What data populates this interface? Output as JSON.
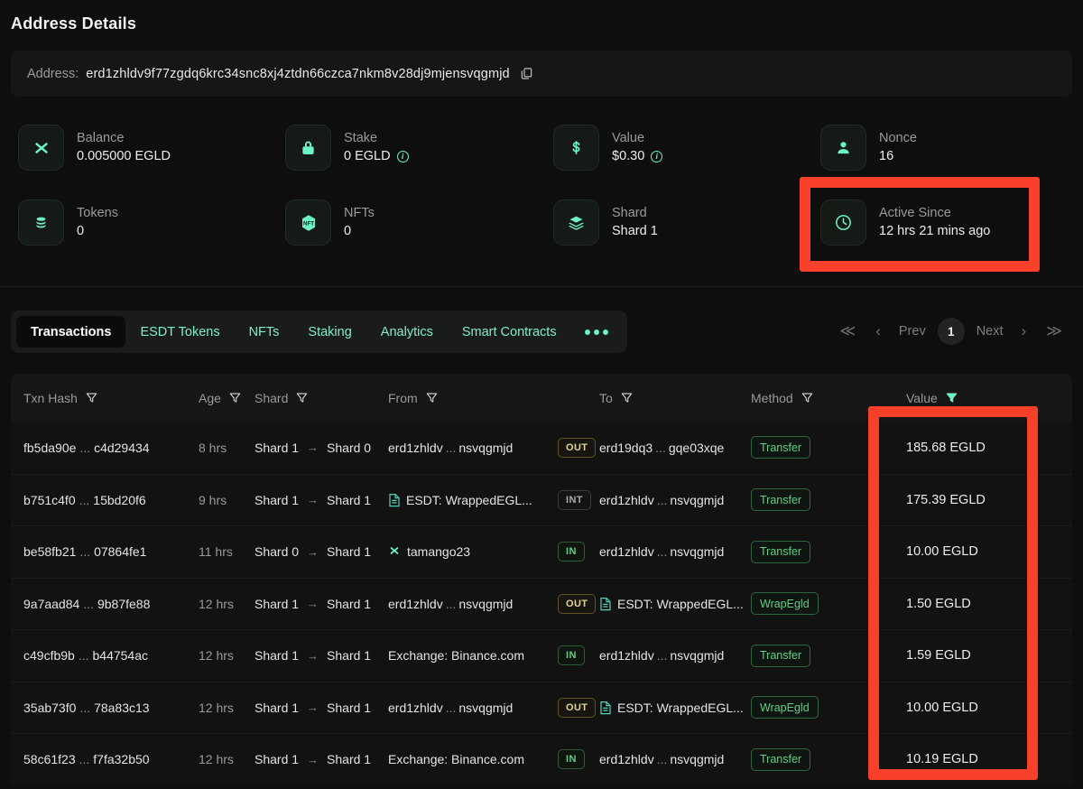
{
  "page": {
    "title": "Address Details"
  },
  "address": {
    "label": "Address:",
    "value": "erd1zhldv9f77zgdq6krc34snc8xj4ztdn66czca7nkm8v28dj9mjensvqgmjd",
    "copy_icon": "copy-icon"
  },
  "stats": [
    {
      "icon": "egld-logo-icon",
      "label": "Balance",
      "value": "0.005000 EGLD",
      "info": false
    },
    {
      "icon": "lock-icon",
      "label": "Stake",
      "value": "0 EGLD",
      "info": true
    },
    {
      "icon": "dollar-icon",
      "label": "Value",
      "value": "$0.30",
      "info": true
    },
    {
      "icon": "user-icon",
      "label": "Nonce",
      "value": "16",
      "info": false
    },
    {
      "icon": "coins-icon",
      "label": "Tokens",
      "value": "0",
      "info": false
    },
    {
      "icon": "nft-icon",
      "label": "NFTs",
      "value": "0",
      "info": false
    },
    {
      "icon": "layers-icon",
      "label": "Shard",
      "value": "Shard 1",
      "info": false
    },
    {
      "icon": "clock-icon",
      "label": "Active Since",
      "value": "12 hrs 21 mins ago",
      "info": false
    }
  ],
  "tabs": [
    {
      "label": "Transactions",
      "active": true
    },
    {
      "label": "ESDT Tokens",
      "active": false
    },
    {
      "label": "NFTs",
      "active": false
    },
    {
      "label": "Staking",
      "active": false
    },
    {
      "label": "Analytics",
      "active": false
    },
    {
      "label": "Smart Contracts",
      "active": false
    }
  ],
  "tabs_more_icon": "more-dots-icon",
  "pagination": {
    "first_icon": "double-chevron-left-icon",
    "prev_icon": "chevron-left-icon",
    "prev": "Prev",
    "page": "1",
    "next": "Next",
    "next_icon": "chevron-right-icon",
    "last_icon": "double-chevron-right-icon"
  },
  "table": {
    "columns": [
      {
        "label": "Txn Hash",
        "filter": "filter-icon",
        "active_filter": false
      },
      {
        "label": "Age",
        "filter": "filter-icon",
        "active_filter": false
      },
      {
        "label": "Shard",
        "filter": "filter-icon",
        "active_filter": false
      },
      {
        "label": "From",
        "filter": "filter-icon",
        "active_filter": false
      },
      {
        "label": "To",
        "filter": "filter-icon",
        "active_filter": false
      },
      {
        "label": "Method",
        "filter": "filter-icon",
        "active_filter": false
      },
      {
        "label": "Value",
        "filter": "filter-icon-active",
        "active_filter": true
      }
    ],
    "rows": [
      {
        "hash_start": "fb5da90e",
        "hash_end": "c4d29434",
        "age": "8 hrs",
        "shard_from": "Shard 1",
        "shard_to": "Shard 0",
        "from_type": "address",
        "from_start": "erd1zhldv",
        "from_end": "nsvqgmjd",
        "direction": "OUT",
        "to_type": "address",
        "to_start": "erd19dq3",
        "to_end": "gqe03xqe",
        "method": "Transfer",
        "value": "185.68 EGLD"
      },
      {
        "hash_start": "b751c4f0",
        "hash_end": "15bd20f6",
        "age": "9 hrs",
        "shard_from": "Shard 1",
        "shard_to": "Shard 1",
        "from_type": "contract",
        "from_start": "ESDT: WrappedEGL...",
        "from_end": "",
        "direction": "INT",
        "to_type": "address",
        "to_start": "erd1zhldv",
        "to_end": "nsvqgmjd",
        "method": "Transfer",
        "value": "175.39 EGLD"
      },
      {
        "hash_start": "be58fb21",
        "hash_end": "07864fe1",
        "age": "11 hrs",
        "shard_from": "Shard 0",
        "shard_to": "Shard 1",
        "from_type": "herotag",
        "from_start": "tamango23",
        "from_end": "",
        "direction": "IN",
        "to_type": "address",
        "to_start": "erd1zhldv",
        "to_end": "nsvqgmjd",
        "method": "Transfer",
        "value": "10.00 EGLD"
      },
      {
        "hash_start": "9a7aad84",
        "hash_end": "9b87fe88",
        "age": "12 hrs",
        "shard_from": "Shard 1",
        "shard_to": "Shard 1",
        "from_type": "address",
        "from_start": "erd1zhldv",
        "from_end": "nsvqgmjd",
        "direction": "OUT",
        "to_type": "contract",
        "to_start": "ESDT: WrappedEGL...",
        "to_end": "",
        "method": "WrapEgld",
        "value": "1.50 EGLD"
      },
      {
        "hash_start": "c49cfb9b",
        "hash_end": "b44754ac",
        "age": "12 hrs",
        "shard_from": "Shard 1",
        "shard_to": "Shard 1",
        "from_type": "exchange",
        "from_start": "Exchange: Binance.com",
        "from_end": "",
        "direction": "IN",
        "to_type": "address",
        "to_start": "erd1zhldv",
        "to_end": "nsvqgmjd",
        "method": "Transfer",
        "value": "1.59 EGLD"
      },
      {
        "hash_start": "35ab73f0",
        "hash_end": "78a83c13",
        "age": "12 hrs",
        "shard_from": "Shard 1",
        "shard_to": "Shard 1",
        "from_type": "address",
        "from_start": "erd1zhldv",
        "from_end": "nsvqgmjd",
        "direction": "OUT",
        "to_type": "contract",
        "to_start": "ESDT: WrappedEGL...",
        "to_end": "",
        "method": "WrapEgld",
        "value": "10.00 EGLD"
      },
      {
        "hash_start": "58c61f23",
        "hash_end": "f7fa32b50",
        "age": "12 hrs",
        "shard_from": "Shard 1",
        "shard_to": "Shard 1",
        "from_type": "exchange",
        "from_start": "Exchange: Binance.com",
        "from_end": "",
        "direction": "IN",
        "to_type": "address",
        "to_start": "erd1zhldv",
        "to_end": "nsvqgmjd",
        "method": "Transfer",
        "value": "10.19 EGLD"
      }
    ],
    "ellipsis": "...",
    "arrow": "→"
  },
  "highlights": [
    {
      "name": "active-since-highlight",
      "color": "#f8402a"
    },
    {
      "name": "value-column-highlight",
      "color": "#f8402a"
    }
  ],
  "colors": {
    "accent": "#6df3c9",
    "highlight": "#f8402a",
    "page_bg": "#0e0e0e",
    "card_bg": "#161616"
  }
}
